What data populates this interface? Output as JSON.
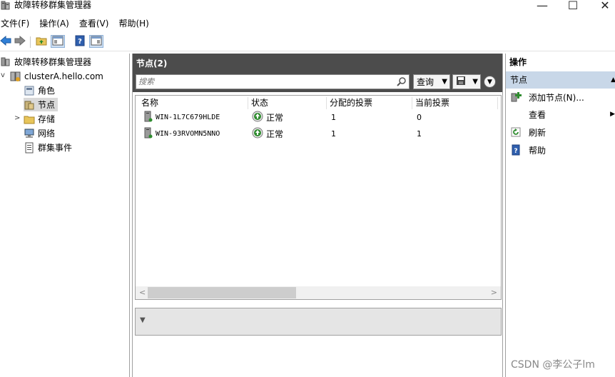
{
  "window": {
    "title": "故障转移群集管理器",
    "min_glyph": "—",
    "max_glyph": "☐",
    "close_glyph": "✕"
  },
  "menu": [
    "文件(F)",
    "操作(A)",
    "查看(V)",
    "帮助(H)"
  ],
  "tree": {
    "root": "故障转移群集管理器",
    "cluster": "clusterA.hello.com",
    "children": [
      "角色",
      "节点",
      "存储",
      "网络",
      "群集事件"
    ],
    "selected": "节点"
  },
  "center": {
    "header": "节点(2)",
    "search_placeholder": "搜索",
    "query_label": "查询",
    "columns": [
      "名称",
      "状态",
      "分配的投票",
      "当前投票"
    ],
    "rows": [
      {
        "name": "WIN-1L7C679HLDE",
        "status": "正常",
        "assigned_votes": "1",
        "current_votes": "0"
      },
      {
        "name": "WIN-93RVOMN5NNO",
        "status": "正常",
        "assigned_votes": "1",
        "current_votes": "1"
      }
    ]
  },
  "actions": {
    "header": "操作",
    "section": "节点",
    "items": [
      {
        "label": "添加节点(N)...",
        "icon": "add-node-icon"
      },
      {
        "label": "查看",
        "icon": "none"
      },
      {
        "label": "刷新",
        "icon": "refresh-icon"
      },
      {
        "label": "帮助",
        "icon": "help-icon"
      }
    ]
  },
  "watermark": "CSDN @李公子lm",
  "colors": {
    "header_bg": "#4c4c4c",
    "section_bg": "#c8d7e8",
    "status_ok": "#2e8b2e"
  }
}
